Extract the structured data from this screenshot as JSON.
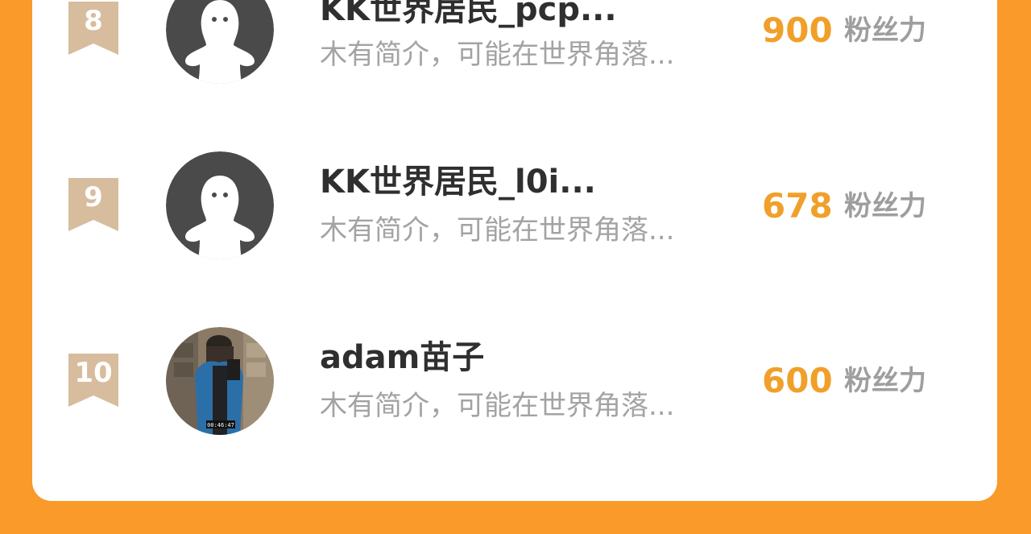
{
  "colors": {
    "page_background": "#F99A2A",
    "card": "#FFFFFF",
    "rank_badge": "#D7BC9D",
    "score": "#F0A02A",
    "unit": "#9E9E9E",
    "name": "#2F2F2F",
    "bio": "#A3A3A3"
  },
  "rows": [
    {
      "rank": "8",
      "name": "KK世界居民_pcp...",
      "bio": "木有简介，可能在世界角落...",
      "score": "900",
      "unit": "粉丝力",
      "avatar": "default-avatar-icon"
    },
    {
      "rank": "9",
      "name": "KK世界居民_l0i...",
      "bio": "木有简介，可能在世界角落...",
      "score": "678",
      "unit": "粉丝力",
      "avatar": "default-avatar-icon"
    },
    {
      "rank": "10",
      "name": "adam苗子",
      "bio": "木有简介，可能在世界角落...",
      "score": "600",
      "unit": "粉丝力",
      "avatar": "user-photo"
    }
  ]
}
